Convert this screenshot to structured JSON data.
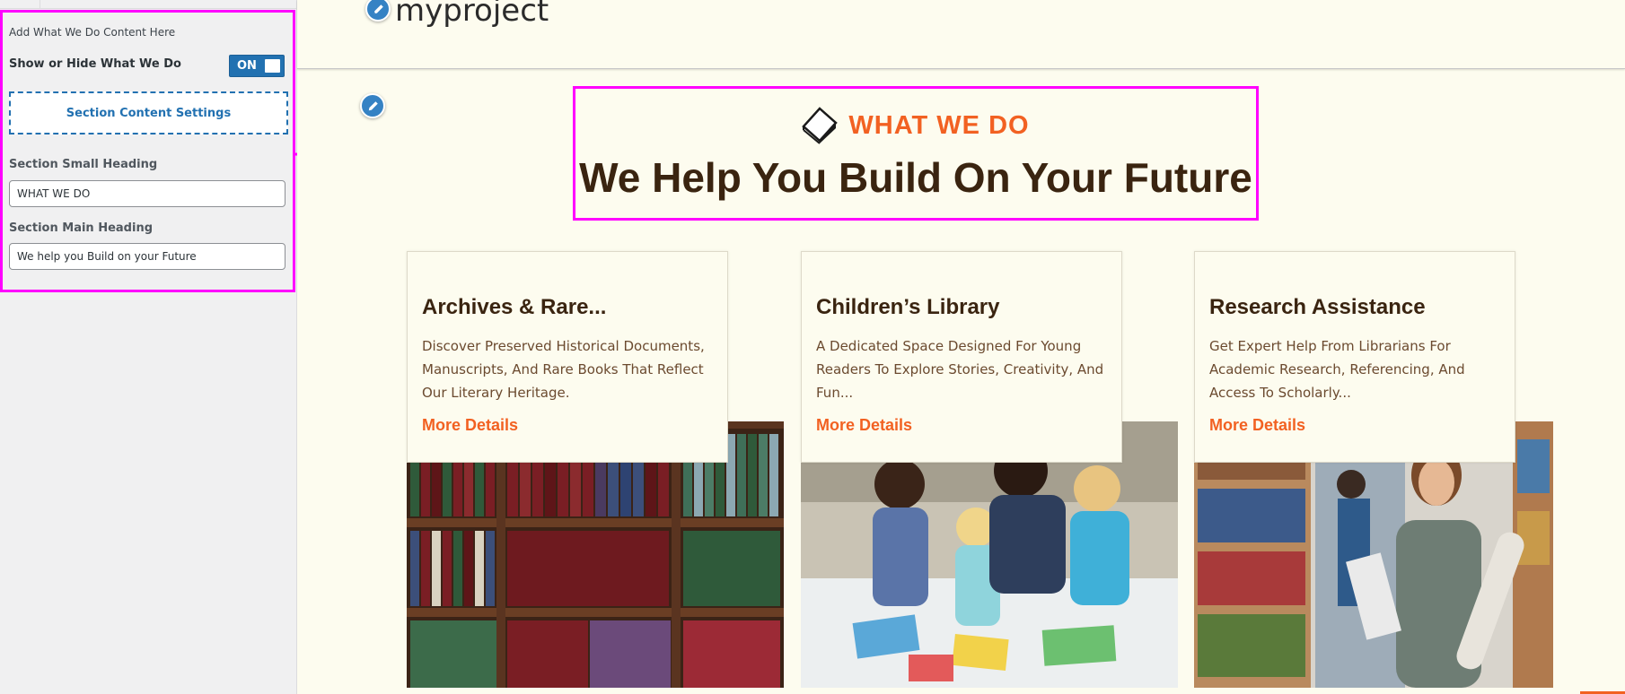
{
  "customizer": {
    "description": "Add What We Do Content Here",
    "toggle_label": "Show or Hide What We Do",
    "toggle_state": "ON",
    "section_settings_label": "Section Content Settings",
    "small_heading_label": "Section Small Heading",
    "small_heading_value": "WHAT WE DO",
    "main_heading_label": "Section Main Heading",
    "main_heading_value": "We help you Build on your Future"
  },
  "site": {
    "title": "myproject"
  },
  "section": {
    "small_heading": "WHAT WE DO",
    "main_heading": "We Help You Build On Your Future"
  },
  "cards": [
    {
      "title": "Archives & Rare...",
      "description": "Discover Preserved Historical Documents, Manuscripts, And Rare Books That Reflect Our Literary Heritage.",
      "link": "More Details"
    },
    {
      "title": "Children’s Library",
      "description": "A Dedicated Space Designed For Young Readers To Explore Stories, Creativity, And Fun...",
      "link": "More Details"
    },
    {
      "title": "Research Assistance",
      "description": "Get Expert Help From Librarians For Academic Research, Referencing, And Access To Scholarly...",
      "link": "More Details"
    }
  ],
  "colors": {
    "accent": "#f26122",
    "heading": "#3a2410",
    "highlight": "#ff00ff",
    "wp_blue": "#2271b1",
    "background": "#fdfcef"
  },
  "icons": {
    "edit": "pencil-icon",
    "section": "book-icon"
  }
}
